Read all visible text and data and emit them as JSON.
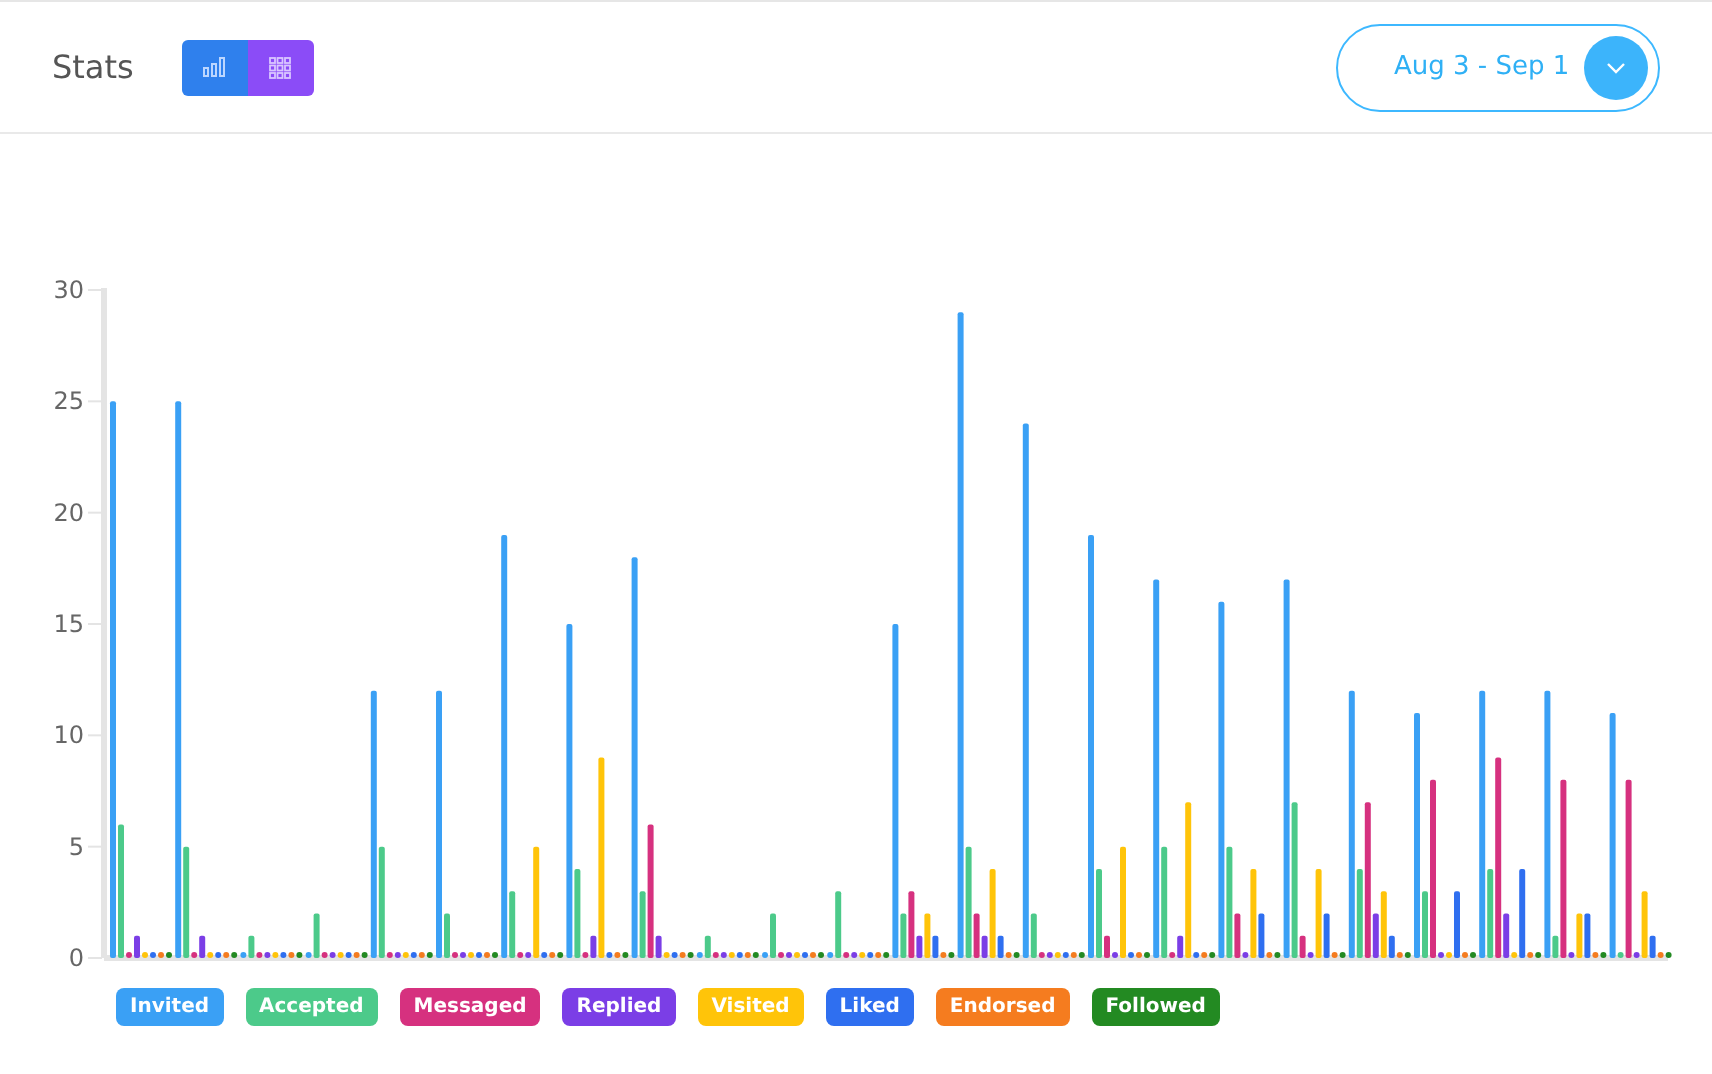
{
  "header": {
    "title": "Stats",
    "date_range": "Aug 3 - Sep 1"
  },
  "chart_data": {
    "type": "bar",
    "ylim": [
      0,
      30
    ],
    "yticks": [
      0,
      5,
      10,
      15,
      20,
      25,
      30
    ],
    "series": [
      {
        "name": "Invited",
        "color": "#3aa0f5",
        "values": [
          25,
          25,
          0,
          0,
          12,
          12,
          19,
          15,
          18,
          0,
          0,
          0,
          15,
          29,
          24,
          19,
          17,
          16,
          17,
          12,
          11,
          12,
          12,
          11
        ]
      },
      {
        "name": "Accepted",
        "color": "#4cca8a",
        "values": [
          6,
          5,
          1,
          2,
          5,
          2,
          3,
          4,
          3,
          1,
          2,
          3,
          2,
          5,
          2,
          4,
          5,
          5,
          7,
          4,
          3,
          4,
          1,
          0
        ]
      },
      {
        "name": "Messaged",
        "color": "#d6317f",
        "values": [
          0,
          0,
          0,
          0,
          0,
          0,
          0,
          0,
          6,
          0,
          0,
          0,
          3,
          2,
          0,
          1,
          0,
          2,
          1,
          7,
          8,
          9,
          8,
          8
        ]
      },
      {
        "name": "Replied",
        "color": "#7b3ee6",
        "values": [
          1,
          1,
          0,
          0,
          0,
          0,
          0,
          1,
          1,
          0,
          0,
          0,
          1,
          1,
          0,
          0,
          1,
          0,
          0,
          2,
          0,
          2,
          0,
          0
        ]
      },
      {
        "name": "Visited",
        "color": "#ffc409",
        "values": [
          0,
          0,
          0,
          0,
          0,
          0,
          5,
          9,
          0,
          0,
          0,
          0,
          2,
          4,
          0,
          5,
          7,
          4,
          4,
          3,
          0,
          0,
          2,
          3
        ]
      },
      {
        "name": "Liked",
        "color": "#2f6ff0",
        "values": [
          0,
          0,
          0,
          0,
          0,
          0,
          0,
          0,
          0,
          0,
          0,
          0,
          1,
          1,
          0,
          0,
          0,
          2,
          2,
          1,
          3,
          4,
          2,
          1
        ]
      },
      {
        "name": "Endorsed",
        "color": "#f57c1f",
        "values": [
          0,
          0,
          0,
          0,
          0,
          0,
          0,
          0,
          0,
          0,
          0,
          0,
          0,
          0,
          0,
          0,
          0,
          0,
          0,
          0,
          0,
          0,
          0,
          0
        ]
      },
      {
        "name": "Followed",
        "color": "#238a22",
        "values": [
          0,
          0,
          0,
          0,
          0,
          0,
          0,
          0,
          0,
          0,
          0,
          0,
          0,
          0,
          0,
          0,
          0,
          0,
          0,
          0,
          0,
          0,
          0,
          0
        ]
      }
    ]
  }
}
